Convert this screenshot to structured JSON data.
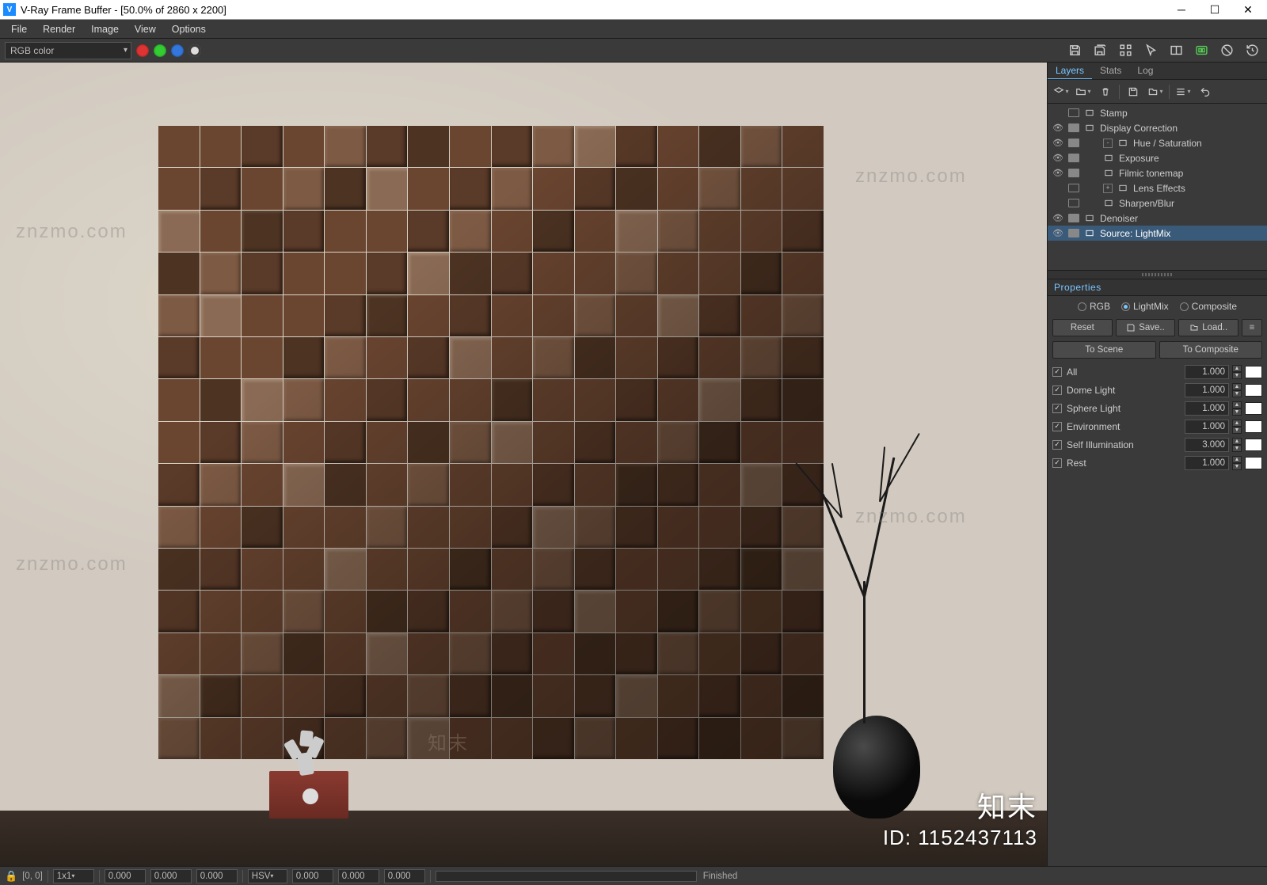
{
  "window": {
    "title": "V-Ray Frame Buffer - [50.0% of 2860 x 2200]",
    "logo_letter": "V"
  },
  "menu": {
    "items": [
      "File",
      "Render",
      "Image",
      "View",
      "Options"
    ]
  },
  "channel_select": {
    "value": "RGB color"
  },
  "toolbar_icons": [
    "save-image-icon",
    "save-all-icon",
    "pick-pixel-icon",
    "region-icon",
    "compare-icon",
    "vr-icon",
    "clear-icon",
    "history-icon"
  ],
  "side": {
    "tabs": {
      "items": [
        "Layers",
        "Stats",
        "Log"
      ],
      "active": 0
    },
    "toolbar_icons": [
      "add-layer-icon",
      "folder-icon",
      "delete-icon",
      "save-layers-icon",
      "load-layers-icon",
      "menu-icon",
      "undo-icon"
    ],
    "layers": [
      {
        "eye": false,
        "indent": 0,
        "expand": null,
        "icon": "lborder",
        "label": "Stamp",
        "selected": false
      },
      {
        "eye": true,
        "indent": 0,
        "expand": null,
        "icon": "lborder filled",
        "label": "Display Correction",
        "selected": false
      },
      {
        "eye": true,
        "indent": 1,
        "expand": "-",
        "icon": "hs",
        "label": "Hue / Saturation",
        "selected": false
      },
      {
        "eye": true,
        "indent": 1,
        "expand": null,
        "icon": "exp",
        "label": "Exposure",
        "selected": false
      },
      {
        "eye": true,
        "indent": 1,
        "expand": null,
        "icon": "fm",
        "label": "Filmic tonemap",
        "selected": false
      },
      {
        "eye": false,
        "indent": 1,
        "expand": "+",
        "icon": "le",
        "label": "Lens Effects",
        "selected": false
      },
      {
        "eye": false,
        "indent": 1,
        "expand": null,
        "icon": "sb",
        "label": "Sharpen/Blur",
        "selected": false
      },
      {
        "eye": true,
        "indent": 0,
        "expand": null,
        "icon": "lborder",
        "label": "Denoiser",
        "selected": false
      },
      {
        "eye": true,
        "indent": 0,
        "expand": null,
        "icon": "src",
        "label": "Source: LightMix",
        "selected": true
      }
    ]
  },
  "properties": {
    "header": "Properties",
    "mode": {
      "options": [
        "RGB",
        "LightMix",
        "Composite"
      ],
      "selected": 1
    },
    "primary_buttons": {
      "reset": "Reset",
      "save": "Save..",
      "load": "Load..",
      "menu": "≡"
    },
    "secondary_buttons": {
      "to_scene": "To Scene",
      "to_composite": "To Composite"
    },
    "lights": [
      {
        "on": true,
        "label": "All",
        "value": "1.000"
      },
      {
        "on": true,
        "label": "Dome Light",
        "value": "1.000"
      },
      {
        "on": true,
        "label": "Sphere Light",
        "value": "1.000"
      },
      {
        "on": true,
        "label": "Environment",
        "value": "1.000"
      },
      {
        "on": true,
        "label": "Self Illumination",
        "value": "3.000"
      },
      {
        "on": true,
        "label": "Rest",
        "value": "1.000"
      }
    ]
  },
  "statusbar": {
    "coords": "[0, 0]",
    "zoom": "1x1",
    "raw_rgb": [
      "0.000",
      "0.000",
      "0.000"
    ],
    "mode_label": "HSV",
    "hsv": [
      "0.000",
      "0.000",
      "0.000"
    ],
    "status": "Finished"
  },
  "watermark": {
    "brand_zh": "知末",
    "brand_en": "znzmo.com",
    "id_label": "ID: 1152437113"
  }
}
